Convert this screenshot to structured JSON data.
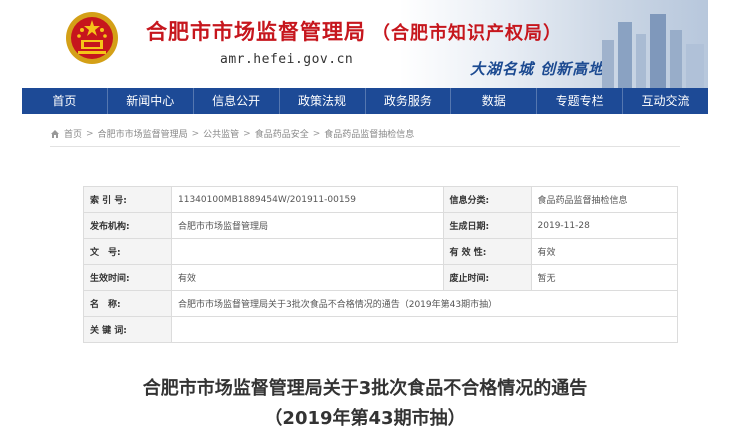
{
  "header": {
    "title": "合肥市市场监督管理局",
    "subtitle": "（合肥市知识产权局）",
    "url": "amr.hefei.gov.cn",
    "slogan": "大湖名城  创新高地"
  },
  "nav": {
    "items": [
      "首页",
      "新闻中心",
      "信息公开",
      "政策法规",
      "政务服务",
      "数据",
      "专题专栏",
      "互动交流"
    ]
  },
  "breadcrumb": {
    "items": [
      "首页",
      "合肥市市场监督管理局",
      "公共监管",
      "食品药品安全",
      "食品药品监督抽检信息"
    ],
    "separator": ">"
  },
  "info": {
    "rows": [
      {
        "k1": "索 引 号:",
        "v1": "11340100MB1889454W/201911-00159",
        "k2": "信息分类:",
        "v2": "食品药品监督抽检信息"
      },
      {
        "k1": "发布机构:",
        "v1": "合肥市市场监督管理局",
        "k2": "生成日期:",
        "v2": "2019-11-28"
      },
      {
        "k1": "文　号:",
        "v1": "",
        "k2": "有 效 性:",
        "v2": "有效"
      },
      {
        "k1": "生效时间:",
        "v1": "有效",
        "k2": "废止时间:",
        "v2": "暂无"
      }
    ],
    "name_label": "名　称:",
    "name_value": "合肥市市场监督管理局关于3批次食品不合格情况的通告（2019年第43期市抽）",
    "keywords_label": "关 键 词:",
    "keywords_value": ""
  },
  "article": {
    "title_line1": "合肥市市场监督管理局关于3批次食品不合格情况的通告",
    "title_line2": "（2019年第43期市抽）"
  },
  "colors": {
    "brand_red": "#c6161d",
    "nav_blue": "#1d4a96"
  }
}
